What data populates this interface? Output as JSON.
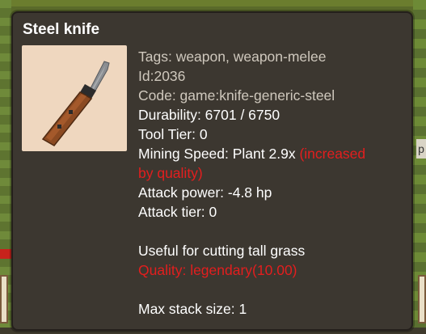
{
  "background": {
    "right_button_glyph": "p"
  },
  "tooltip": {
    "title": "Steel knife",
    "item_icon": "steel-knife-icon",
    "tags": "Tags: weapon, weapon-melee",
    "id": "Id:2036",
    "code": "Code: game:knife-generic-steel",
    "durability": "Durability: 6701 / 6750",
    "tool_tier": "Tool Tier: 0",
    "mining_speed_prefix": "Mining Speed: Plant 2.9x ",
    "mining_speed_suffix_1": "(increased",
    "mining_speed_suffix_2": "by quality)",
    "attack_power": "Attack power: -4.8 hp",
    "attack_tier": "Attack tier: 0",
    "description": "Useful for cutting tall grass",
    "quality": "Quality: legendary(10.00)",
    "max_stack": "Max stack size: 1"
  },
  "colors": {
    "panel_bg": "#3c3730",
    "text": "#ffffff",
    "dim_text": "#cfc8bd",
    "highlight": "#e31e1e",
    "icon_frame": "#efd7bf"
  }
}
